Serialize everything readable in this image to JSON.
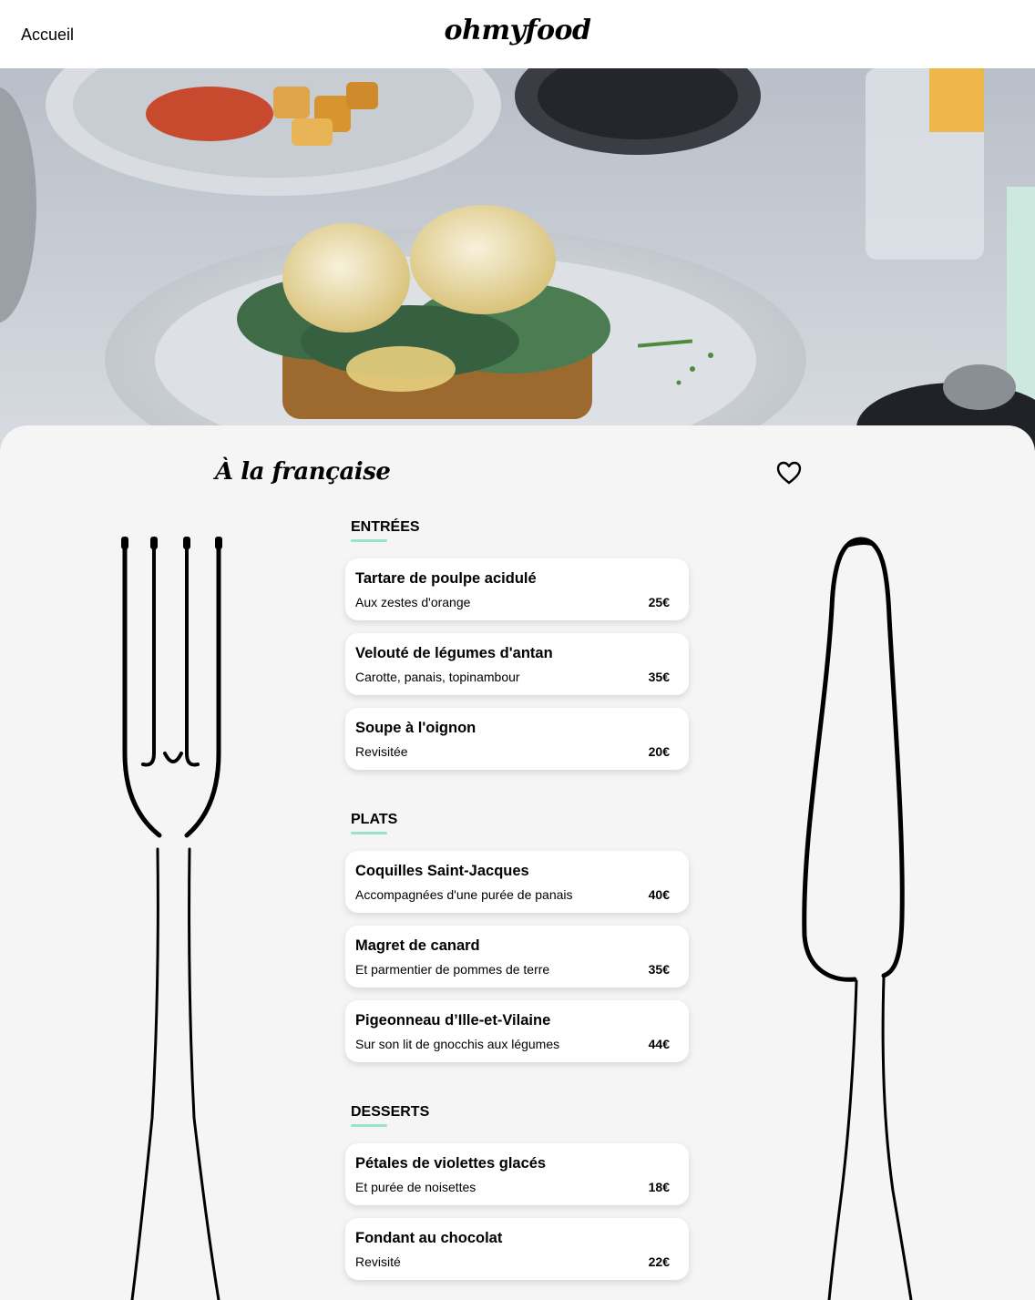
{
  "header": {
    "back_label": "Accueil",
    "logo": "ohmyfood"
  },
  "hero": {
    "image_alt": "Poached eggs with hollandaise sauce on spinach and toast"
  },
  "restaurant": {
    "title": "À la française",
    "favorite_icon": "heart-outline-icon"
  },
  "decor": {
    "left_icon": "fork-icon",
    "right_icon": "knife-icon"
  },
  "colors": {
    "accent": "#99e2d0",
    "panel_bg": "#f5f5f5",
    "card_bg": "#ffffff"
  },
  "menu": {
    "sections": [
      {
        "title": "ENTRÉES",
        "dishes": [
          {
            "name": "Tartare de poulpe acidulé",
            "desc": "Aux zestes d'orange",
            "price": "25€"
          },
          {
            "name": "Velouté de légumes d'antan",
            "desc": "Carotte, panais, topinambour",
            "price": "35€"
          },
          {
            "name": "Soupe à l'oignon",
            "desc": "Revisitée",
            "price": "20€"
          }
        ]
      },
      {
        "title": "PLATS",
        "dishes": [
          {
            "name": "Coquilles Saint-Jacques",
            "desc": "Accompagnées d'une purée de panais",
            "price": "40€"
          },
          {
            "name": "Magret de canard",
            "desc": "Et parmentier de pommes de terre",
            "price": "35€"
          },
          {
            "name": "Pigeonneau d’Ille-et-Vilaine",
            "desc": "Sur son lit de gnocchis aux légumes",
            "price": "44€"
          }
        ]
      },
      {
        "title": "DESSERTS",
        "dishes": [
          {
            "name": "Pétales de violettes glacés",
            "desc": "Et purée de noisettes",
            "price": "18€"
          },
          {
            "name": "Fondant au chocolat",
            "desc": "Revisité",
            "price": "22€"
          }
        ]
      }
    ]
  }
}
